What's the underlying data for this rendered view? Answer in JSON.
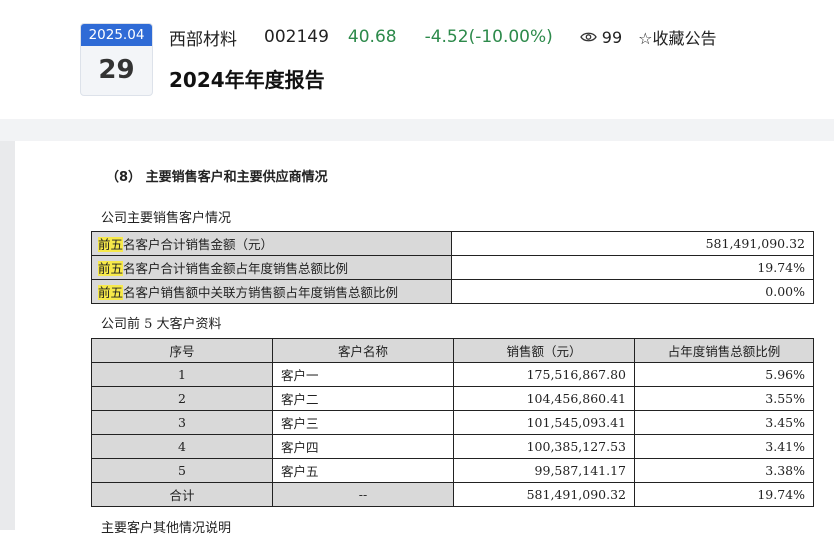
{
  "header": {
    "date_month": "2025.04",
    "date_day": "29",
    "company": "西部材料",
    "code": "002149",
    "price": "40.68",
    "change": "-4.52(-10.00%)",
    "views": "99",
    "favorite_label": "☆收藏公告",
    "title": "2024年年度报告"
  },
  "colors": {
    "accent": "#2f6bd6",
    "down": "#2d8a4b",
    "highlight": "#f7e94a"
  },
  "doc": {
    "section_heading": "（8） 主要销售客户和主要供应商情况",
    "subtitle1": "公司主要销售客户情况",
    "summary": [
      {
        "hl": "前五",
        "label": "名客户合计销售金额（元）",
        "value": "581,491,090.32"
      },
      {
        "hl": "前五",
        "label": "名客户合计销售金额占年度销售总额比例",
        "value": "19.74%"
      },
      {
        "hl": "前五",
        "label": "名客户销售额中关联方销售额占年度销售总额比例",
        "value": "0.00%"
      }
    ],
    "subtitle2": "公司前 5 大客户资料",
    "columns": [
      "序号",
      "客户名称",
      "销售额（元）",
      "占年度销售总额比例"
    ],
    "rows": [
      {
        "no": "1",
        "name": "客户一",
        "amount": "175,516,867.80",
        "ratio": "5.96%"
      },
      {
        "no": "2",
        "name": "客户二",
        "amount": "104,456,860.41",
        "ratio": "3.55%"
      },
      {
        "no": "3",
        "name": "客户三",
        "amount": "101,545,093.41",
        "ratio": "3.45%"
      },
      {
        "no": "4",
        "name": "客户四",
        "amount": "100,385,127.53",
        "ratio": "3.41%"
      },
      {
        "no": "5",
        "name": "客户五",
        "amount": "99,587,141.17",
        "ratio": "3.38%"
      }
    ],
    "total": {
      "label": "合计",
      "name": "--",
      "amount": "581,491,090.32",
      "ratio": "19.74%"
    },
    "subtitle3": "主要客户其他情况说明"
  }
}
